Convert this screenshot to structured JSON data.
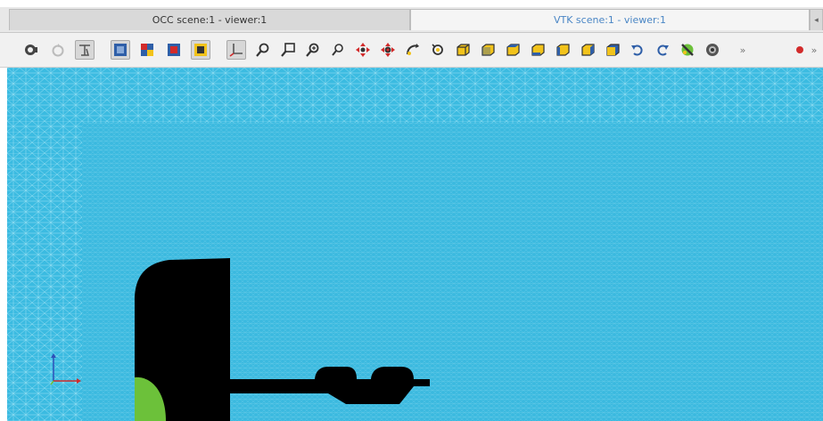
{
  "tabs": {
    "occ": "OCC scene:1 - viewer:1",
    "vtk": "VTK scene:1 - viewer:1"
  },
  "toolbar": {
    "overflow_label": "»"
  },
  "colors": {
    "mesh_fill": "#3bbbe1",
    "mesh_line": "#7fd6ef",
    "solid_body": "#000000",
    "highlight_face": "#6cc13a",
    "active_tab_text": "#4a86c5",
    "icon_blue": "#2f5fa8",
    "icon_yellow": "#f2c31b",
    "icon_red": "#d22b2b"
  },
  "icons": [
    "dump-view-icon",
    "reset-view-icon",
    "fit-selection-icon",
    "view-front-icon",
    "view-back-icon",
    "view-top-icon",
    "view-bottom-icon",
    "trihedron-icon",
    "zoom-icon",
    "zoom-window-icon",
    "zoom-in-icon",
    "zoom-out-icon",
    "pan-icon",
    "global-pan-icon",
    "rotate-icon",
    "rotation-point-icon",
    "cube-front-icon",
    "cube-back-icon",
    "cube-top-icon",
    "cube-bottom-icon",
    "cube-left-icon",
    "cube-right-icon",
    "rotate-ccw-icon",
    "rotate-cw-icon",
    "clipping-icon",
    "camera-icon",
    "more-icon",
    "record-icon"
  ]
}
